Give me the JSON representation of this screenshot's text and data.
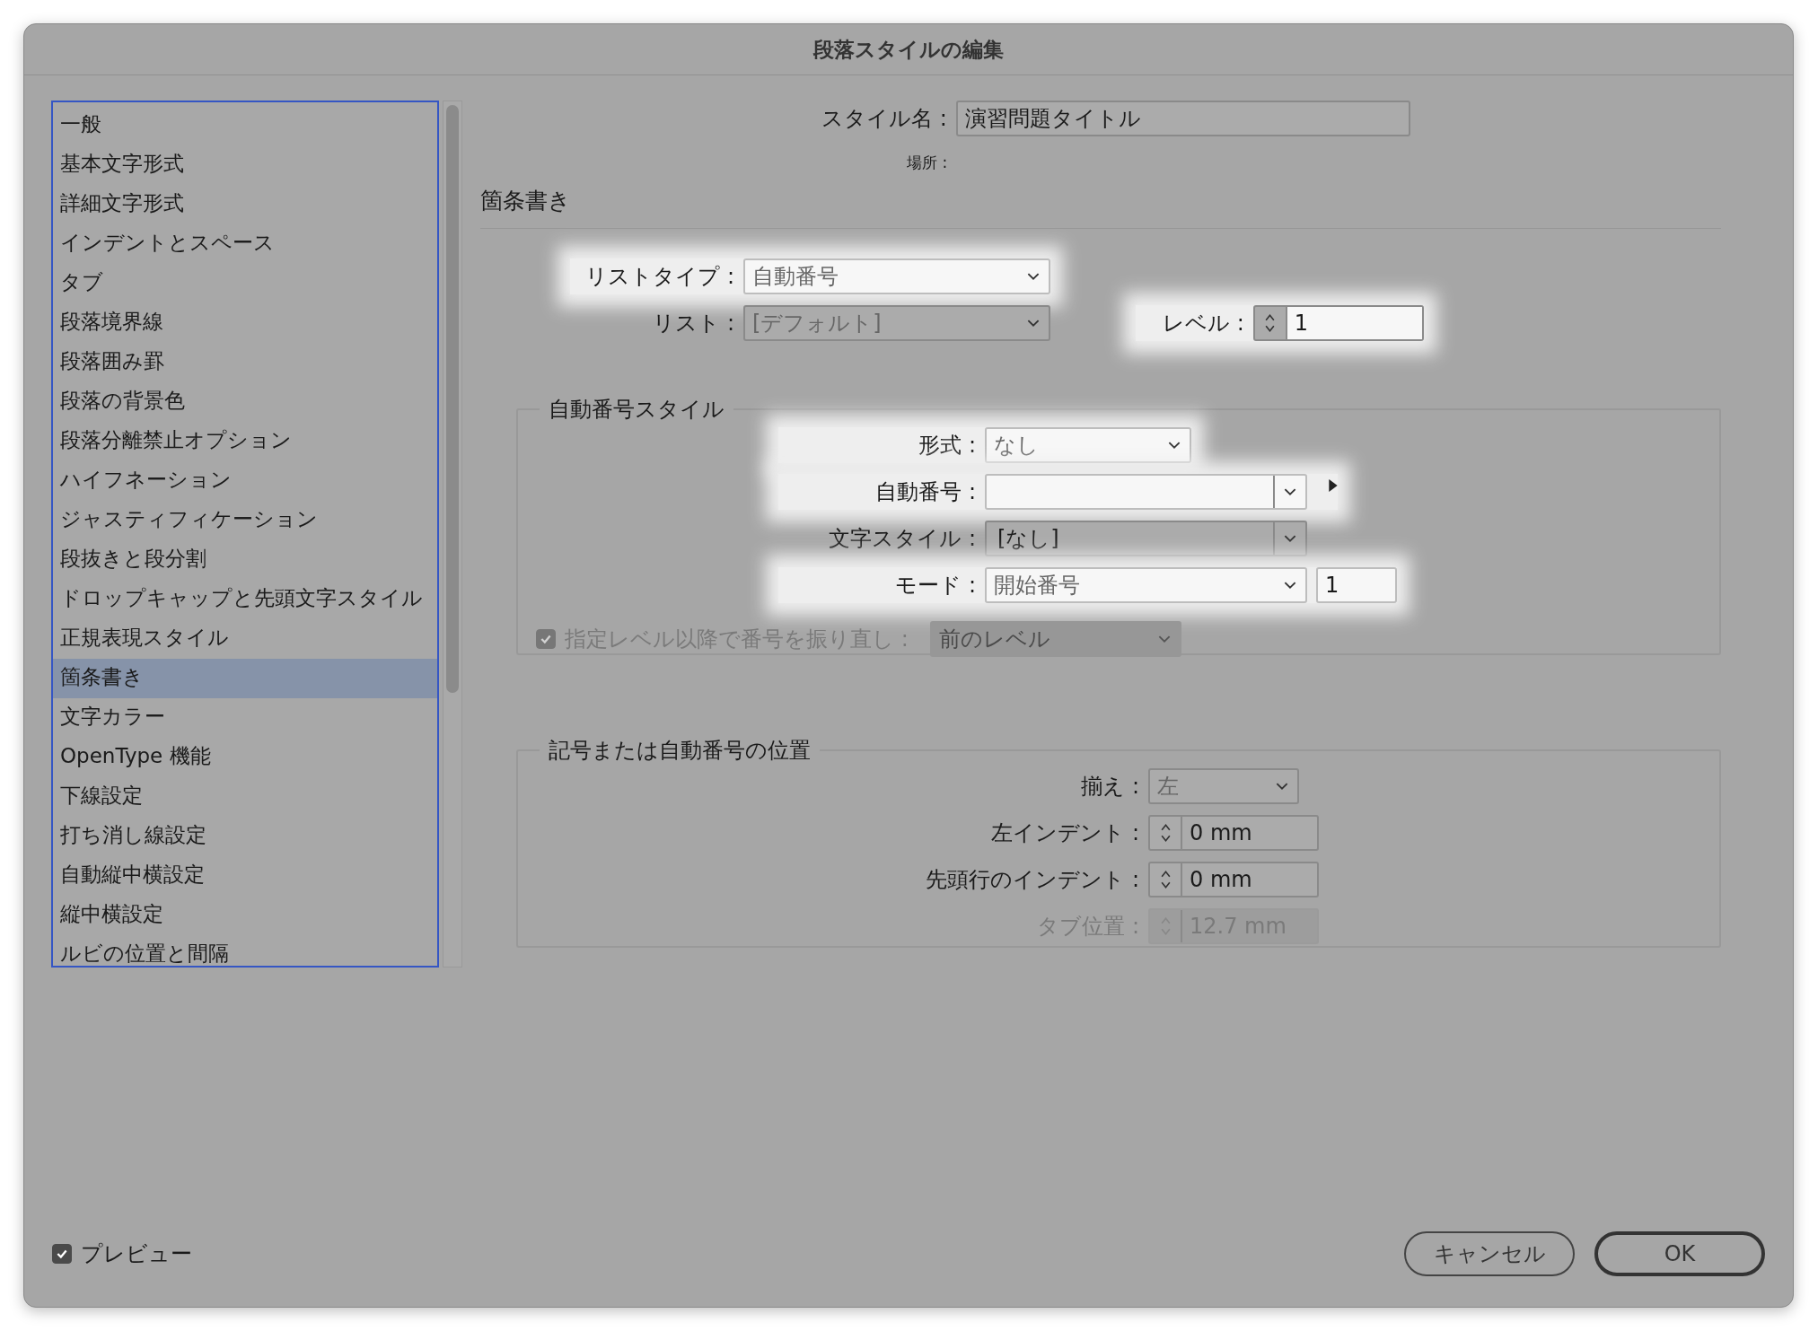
{
  "window": {
    "title": "段落スタイルの編集"
  },
  "sidebar": {
    "items": [
      {
        "label": "一般",
        "selected": false
      },
      {
        "label": "基本文字形式",
        "selected": false
      },
      {
        "label": "詳細文字形式",
        "selected": false
      },
      {
        "label": "インデントとスペース",
        "selected": false
      },
      {
        "label": "タブ",
        "selected": false
      },
      {
        "label": "段落境界線",
        "selected": false
      },
      {
        "label": "段落囲み罫",
        "selected": false
      },
      {
        "label": "段落の背景色",
        "selected": false
      },
      {
        "label": "段落分離禁止オプション",
        "selected": false
      },
      {
        "label": "ハイフネーション",
        "selected": false
      },
      {
        "label": "ジャスティフィケーション",
        "selected": false
      },
      {
        "label": "段抜きと段分割",
        "selected": false
      },
      {
        "label": "ドロップキャップと先頭文字スタイル",
        "selected": false
      },
      {
        "label": "正規表現スタイル",
        "selected": false
      },
      {
        "label": "箇条書き",
        "selected": true
      },
      {
        "label": "文字カラー",
        "selected": false
      },
      {
        "label": "OpenType 機能",
        "selected": false
      },
      {
        "label": "下線設定",
        "selected": false
      },
      {
        "label": "打ち消し線設定",
        "selected": false
      },
      {
        "label": "自動縦中横設定",
        "selected": false
      },
      {
        "label": "縦中横設定",
        "selected": false
      },
      {
        "label": "ルビの位置と間隔",
        "selected": false
      }
    ]
  },
  "style_name": {
    "label": "スタイル名 :",
    "value": "演習問題タイトル"
  },
  "location": {
    "label": "場所 :"
  },
  "section_title": "箇条書き",
  "list_type": {
    "label": "リストタイプ :",
    "value": "自動番号",
    "highlighted": true
  },
  "list": {
    "label": "リスト :",
    "value": "[デフォルト]",
    "highlighted": false
  },
  "level": {
    "label": "レベル :",
    "value": "1",
    "highlighted": true
  },
  "numbering_style": {
    "legend": "自動番号スタイル",
    "rows": [
      {
        "kind": "dropdown",
        "label": "形式 :",
        "value": "なし",
        "highlighted": true
      },
      {
        "kind": "combo",
        "label": "自動番号 :",
        "highlighted": true,
        "flyout": true
      },
      {
        "kind": "combo",
        "label": "文字スタイル :",
        "value": "[なし]",
        "highlighted": false
      },
      {
        "kind": "mode",
        "label": "モード :",
        "value": "開始番号",
        "number": "1",
        "highlighted": true
      },
      {
        "kind": "checkbox",
        "label": "指定レベル以降で番号を振り直し :",
        "value": "前のレベル",
        "checked": true,
        "disabled": true
      }
    ]
  },
  "position": {
    "legend": "記号または自動番号の位置",
    "rows": [
      {
        "kind": "dropdown",
        "label": "揃え :",
        "value": "左",
        "highlighted": false
      },
      {
        "kind": "spinner",
        "label": "左インデント :",
        "value": "0 mm",
        "disabled": false
      },
      {
        "kind": "spinner",
        "label": "先頭行のインデント :",
        "value": "0 mm",
        "disabled": false
      },
      {
        "kind": "spinner",
        "label": "タブ位置 :",
        "value": "12.7 mm",
        "disabled": true
      }
    ]
  },
  "preview": {
    "label": "プレビュー",
    "checked": true
  },
  "buttons": [
    {
      "label": "キャンセル",
      "default": false
    },
    {
      "label": "OK",
      "default": true
    }
  ]
}
